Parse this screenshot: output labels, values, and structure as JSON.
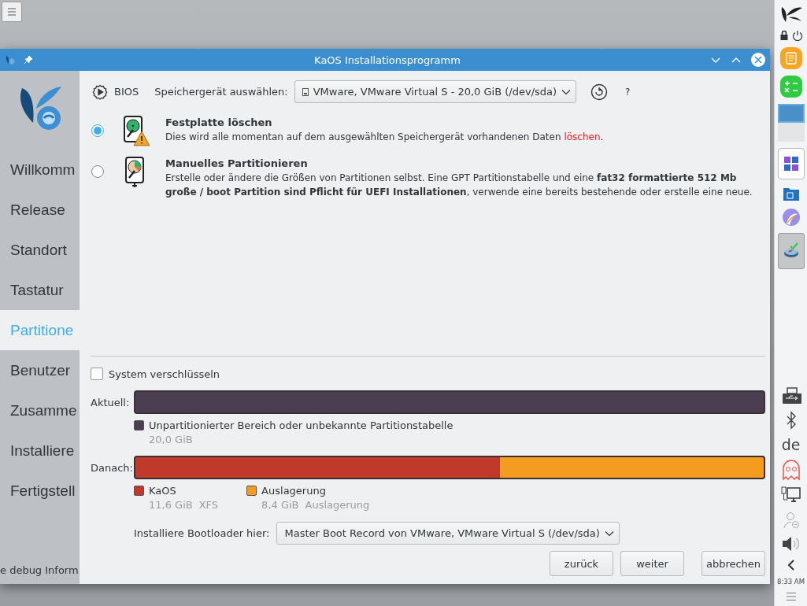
{
  "window": {
    "title": "KaOS Installationsprogramm"
  },
  "sidebar": {
    "items": [
      {
        "label": "Willkomm",
        "selected": false
      },
      {
        "label": "Release",
        "selected": false
      },
      {
        "label": "Standort",
        "selected": false
      },
      {
        "label": "Tastatur",
        "selected": false
      },
      {
        "label": "Partitione",
        "selected": true
      },
      {
        "label": "Benutzer",
        "selected": false
      },
      {
        "label": "Zusamme",
        "selected": false
      },
      {
        "label": "Installiere",
        "selected": false
      },
      {
        "label": "Fertigstell",
        "selected": false
      }
    ],
    "debug_link": "e debug Inform"
  },
  "toolbar": {
    "firmware": "BIOS",
    "device_label": "Speichergerät auswählen:",
    "device_value": "VMware, VMware Virtual S - 20,0 GiB (/dev/sda)",
    "help": "?"
  },
  "options": [
    {
      "kind": "erase",
      "title": "Festplatte löschen",
      "selected": true,
      "description": [
        {
          "kind": "plain",
          "text": "Dies wird alle momentan auf dem ausgewählten Speichergerät vorhandenen Daten "
        },
        {
          "kind": "warning",
          "text": "löschen"
        },
        {
          "kind": "plain",
          "text": "."
        }
      ]
    },
    {
      "kind": "manual",
      "title": "Manuelles Partitionieren",
      "selected": false,
      "description": [
        {
          "kind": "plain",
          "text": "Erstelle oder ändere die Größen von Partitionen selbst. Eine GPT Partitionstabelle und eine **fat32 formattierte 512 Mb große / boot Partition sind Pflicht für UEFI Installationen**, verwende eine bereits bestehende oder erstelle eine neue."
        }
      ]
    }
  ],
  "encrypt": {
    "label": "System verschlüsseln",
    "checked": false
  },
  "current": {
    "label": "Aktuell:",
    "segments": [
      {
        "name": "Unpartitionierter Bereich oder unbekannte Partitionstabelle",
        "size": "20,0 GiB",
        "level": 1,
        "color": "#4b3e50"
      }
    ]
  },
  "after": {
    "label": "Danach:",
    "segments": [
      {
        "name": "KaOS",
        "size": "11,6 GiB",
        "fs": "XFS",
        "level": 0.58,
        "color": "#c0392b"
      },
      {
        "name": "Auslagerung",
        "size": "8,4 GiB",
        "fs": "Auslagerung",
        "level": 0.42,
        "color": "#f39c1f"
      }
    ]
  },
  "bootloader": {
    "label": "Installiere Bootloader hier:",
    "value": "Master Boot Record von VMware, VMware Virtual S (/dev/sda)"
  },
  "buttons": [
    "zurück",
    "weiter",
    "abbrechen"
  ],
  "panel": {
    "layout": "de",
    "clock": "8:33 AM"
  }
}
